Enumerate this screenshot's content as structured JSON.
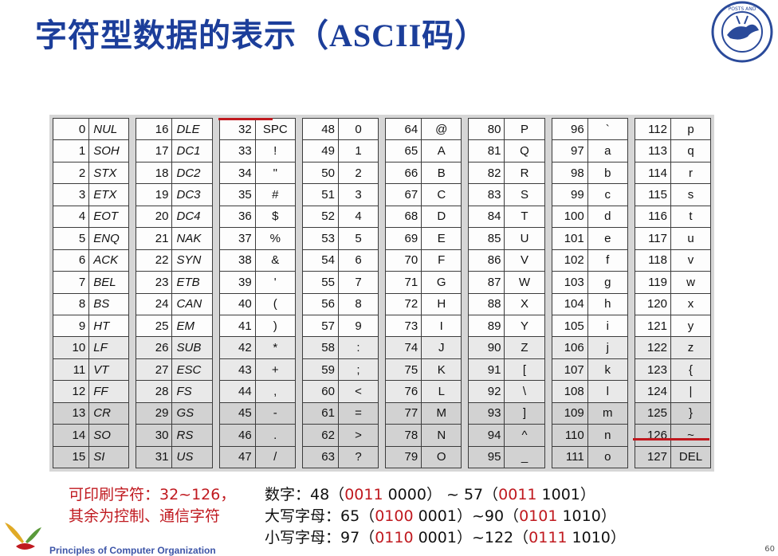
{
  "title_cn": "字符型数据的表示（",
  "title_latin": "ASCII",
  "title_cn2": "码）",
  "columns": [
    [
      [
        "0",
        "NUL"
      ],
      [
        "1",
        "SOH"
      ],
      [
        "2",
        "STX"
      ],
      [
        "3",
        "ETX"
      ],
      [
        "4",
        "EOT"
      ],
      [
        "5",
        "ENQ"
      ],
      [
        "6",
        "ACK"
      ],
      [
        "7",
        "BEL"
      ],
      [
        "8",
        "BS"
      ],
      [
        "9",
        "HT"
      ],
      [
        "10",
        "LF"
      ],
      [
        "11",
        "VT"
      ],
      [
        "12",
        "FF"
      ],
      [
        "13",
        "CR"
      ],
      [
        "14",
        "SO"
      ],
      [
        "15",
        "SI"
      ]
    ],
    [
      [
        "16",
        "DLE"
      ],
      [
        "17",
        "DC1"
      ],
      [
        "18",
        "DC2"
      ],
      [
        "19",
        "DC3"
      ],
      [
        "20",
        "DC4"
      ],
      [
        "21",
        "NAK"
      ],
      [
        "22",
        "SYN"
      ],
      [
        "23",
        "ETB"
      ],
      [
        "24",
        "CAN"
      ],
      [
        "25",
        "EM"
      ],
      [
        "26",
        "SUB"
      ],
      [
        "27",
        "ESC"
      ],
      [
        "28",
        "FS"
      ],
      [
        "29",
        "GS"
      ],
      [
        "30",
        "RS"
      ],
      [
        "31",
        "US"
      ]
    ],
    [
      [
        "32",
        "SPC"
      ],
      [
        "33",
        "!"
      ],
      [
        "34",
        "\""
      ],
      [
        "35",
        "#"
      ],
      [
        "36",
        "$"
      ],
      [
        "37",
        "%"
      ],
      [
        "38",
        "&"
      ],
      [
        "39",
        "'"
      ],
      [
        "40",
        "("
      ],
      [
        "41",
        ")"
      ],
      [
        "42",
        "*"
      ],
      [
        "43",
        "+"
      ],
      [
        "44",
        ","
      ],
      [
        "45",
        "-"
      ],
      [
        "46",
        "."
      ],
      [
        "47",
        "/"
      ]
    ],
    [
      [
        "48",
        "0"
      ],
      [
        "49",
        "1"
      ],
      [
        "50",
        "2"
      ],
      [
        "51",
        "3"
      ],
      [
        "52",
        "4"
      ],
      [
        "53",
        "5"
      ],
      [
        "54",
        "6"
      ],
      [
        "55",
        "7"
      ],
      [
        "56",
        "8"
      ],
      [
        "57",
        "9"
      ],
      [
        "58",
        ":"
      ],
      [
        "59",
        ";"
      ],
      [
        "60",
        "<"
      ],
      [
        "61",
        "="
      ],
      [
        "62",
        ">"
      ],
      [
        "63",
        "?"
      ]
    ],
    [
      [
        "64",
        "@"
      ],
      [
        "65",
        "A"
      ],
      [
        "66",
        "B"
      ],
      [
        "67",
        "C"
      ],
      [
        "68",
        "D"
      ],
      [
        "69",
        "E"
      ],
      [
        "70",
        "F"
      ],
      [
        "71",
        "G"
      ],
      [
        "72",
        "H"
      ],
      [
        "73",
        "I"
      ],
      [
        "74",
        "J"
      ],
      [
        "75",
        "K"
      ],
      [
        "76",
        "L"
      ],
      [
        "77",
        "M"
      ],
      [
        "78",
        "N"
      ],
      [
        "79",
        "O"
      ]
    ],
    [
      [
        "80",
        "P"
      ],
      [
        "81",
        "Q"
      ],
      [
        "82",
        "R"
      ],
      [
        "83",
        "S"
      ],
      [
        "84",
        "T"
      ],
      [
        "85",
        "U"
      ],
      [
        "86",
        "V"
      ],
      [
        "87",
        "W"
      ],
      [
        "88",
        "X"
      ],
      [
        "89",
        "Y"
      ],
      [
        "90",
        "Z"
      ],
      [
        "91",
        "["
      ],
      [
        "92",
        "\\"
      ],
      [
        "93",
        "]"
      ],
      [
        "94",
        "^"
      ],
      [
        "95",
        "_"
      ]
    ],
    [
      [
        "96",
        "`"
      ],
      [
        "97",
        "a"
      ],
      [
        "98",
        "b"
      ],
      [
        "99",
        "c"
      ],
      [
        "100",
        "d"
      ],
      [
        "101",
        "e"
      ],
      [
        "102",
        "f"
      ],
      [
        "103",
        "g"
      ],
      [
        "104",
        "h"
      ],
      [
        "105",
        "i"
      ],
      [
        "106",
        "j"
      ],
      [
        "107",
        "k"
      ],
      [
        "108",
        "l"
      ],
      [
        "109",
        "m"
      ],
      [
        "110",
        "n"
      ],
      [
        "111",
        "o"
      ]
    ],
    [
      [
        "112",
        "p"
      ],
      [
        "113",
        "q"
      ],
      [
        "114",
        "r"
      ],
      [
        "115",
        "s"
      ],
      [
        "116",
        "t"
      ],
      [
        "117",
        "u"
      ],
      [
        "118",
        "v"
      ],
      [
        "119",
        "w"
      ],
      [
        "120",
        "x"
      ],
      [
        "121",
        "y"
      ],
      [
        "122",
        "z"
      ],
      [
        "123",
        "{"
      ],
      [
        "124",
        "|"
      ],
      [
        "125",
        "}"
      ],
      [
        "126",
        "~"
      ],
      [
        "127",
        "DEL"
      ]
    ]
  ],
  "notes_left": [
    "可印刷字符：32~126，",
    "其余为控制、通信字符"
  ],
  "notes_right": [
    {
      "a": "数字：48（",
      "b": "0011",
      "c": " 0000）",
      "d": " ~ 57（",
      "e": "0011",
      "f": " 1001）"
    },
    {
      "a": "大写字母：65（",
      "b": "0100",
      "c": " 0001）",
      "d": "~90（",
      "e": "0101",
      "f": " 1010）"
    },
    {
      "a": "小写字母：97（",
      "b": "0110",
      "c": " 0001）",
      "d": "~122（",
      "e": "0111",
      "f": " 1010）"
    }
  ],
  "footer": "Principles of Computer Organization",
  "page_number": "60",
  "colors": {
    "title": "#1c3e9a",
    "accent": "#c0191f"
  }
}
